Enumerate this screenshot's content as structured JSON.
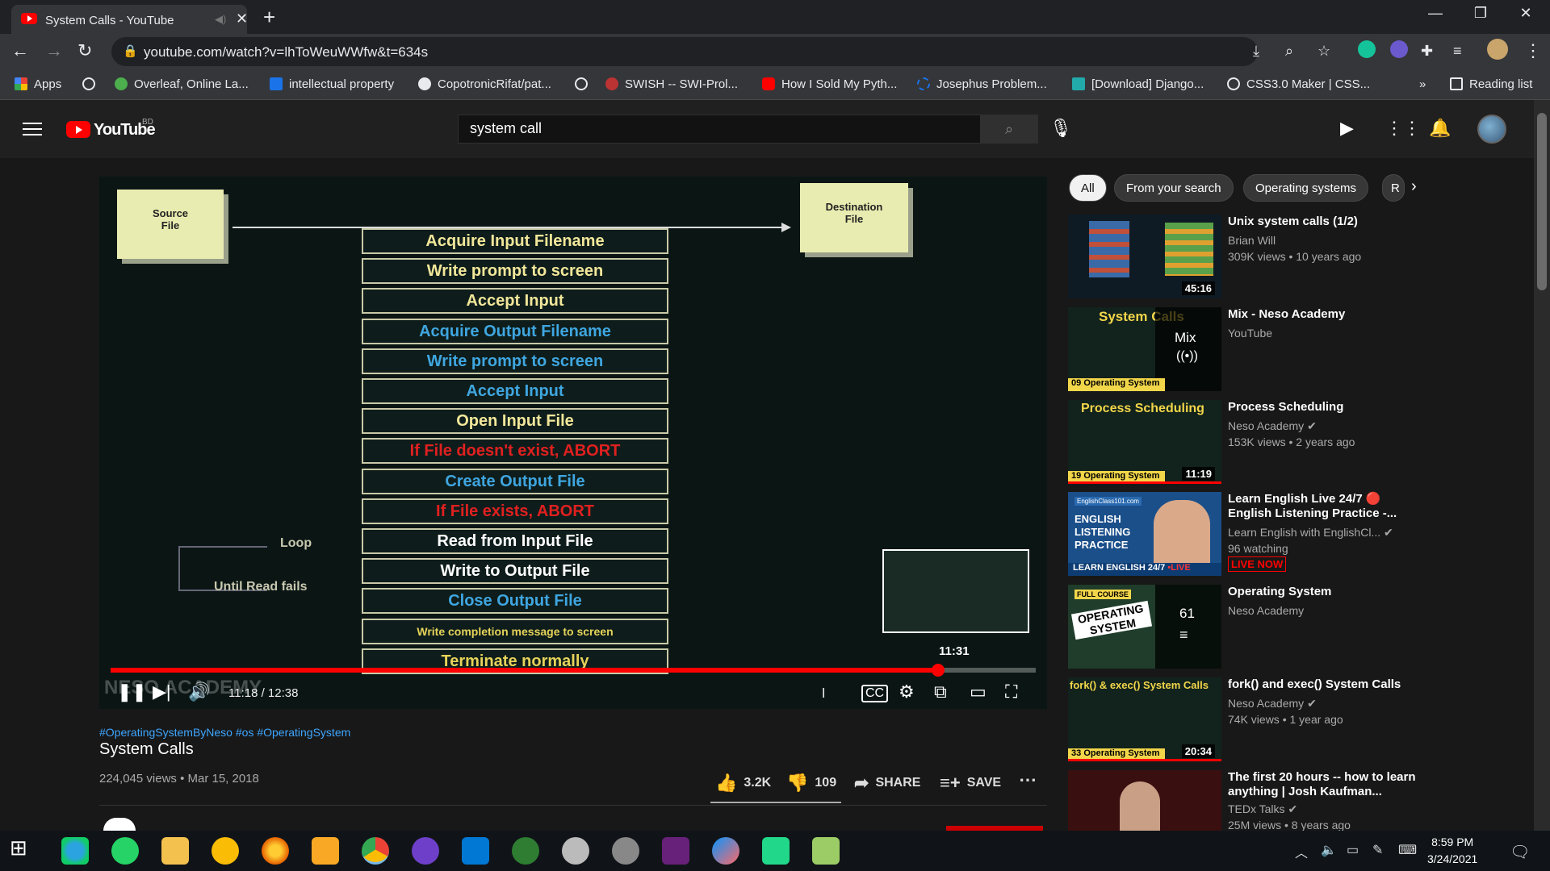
{
  "browser": {
    "tab_title": "System Calls - YouTube",
    "new_tab": "+",
    "url": "youtube.com/watch?v=lhToWeuWWfw&t=634s",
    "bookmarks": [
      {
        "label": "Apps",
        "color": "#e8453c"
      },
      {
        "label": "",
        "color": "#e8eaed"
      },
      {
        "label": "Overleaf, Online La...",
        "color": "#4cae4c"
      },
      {
        "label": "intellectual property",
        "color": "#1a73e8"
      },
      {
        "label": "CopotronicRifat/pat...",
        "color": "#e8eaed"
      },
      {
        "label": "",
        "color": "#e8eaed"
      },
      {
        "label": "SWISH -- SWI-Prol...",
        "color": "#b33"
      },
      {
        "label": "How I Sold My Pyth...",
        "color": "#f00"
      },
      {
        "label": "Josephus Problem...",
        "color": "#1a73e8"
      },
      {
        "label": "[Download] Django...",
        "color": "#2aa"
      },
      {
        "label": "CSS3.0 Maker | CSS...",
        "color": "#e8eaed"
      }
    ],
    "bookmarks_overflow": "»",
    "reading_list": "Reading list"
  },
  "youtube": {
    "logo_text": "YouTube",
    "country_code": "BD",
    "search_value": "system call"
  },
  "player": {
    "slide": {
      "source_label": "Source\nFile",
      "dest_label": "Destination\nFile",
      "steps": [
        {
          "text": "Acquire Input Filename",
          "color": "#f2e79a"
        },
        {
          "text": "Write prompt to screen",
          "color": "#f2e79a"
        },
        {
          "text": "Accept Input",
          "color": "#f2e79a"
        },
        {
          "text": "Acquire Output Filename",
          "color": "#3fa6e0"
        },
        {
          "text": "Write prompt to screen",
          "color": "#3fa6e0"
        },
        {
          "text": "Accept Input",
          "color": "#3fa6e0"
        },
        {
          "text": "Open Input File",
          "color": "#f2e79a"
        },
        {
          "text": "If File doesn't exist, ABORT",
          "color": "#e02020"
        },
        {
          "text": "Create Output File",
          "color": "#3fa6e0"
        },
        {
          "text": "If File exists, ABORT",
          "color": "#e02020"
        },
        {
          "text": "Read from Input File",
          "color": "#ffffff"
        },
        {
          "text": "Write to Output File",
          "color": "#ffffff"
        },
        {
          "text": "Close Output File",
          "color": "#3fa6e0"
        },
        {
          "text": "Write completion message to screen",
          "color": "#e6d35a"
        },
        {
          "text": "Terminate normally",
          "color": "#e6d35a"
        }
      ],
      "loop_label": "Loop",
      "until_label": "Until Read fails",
      "watermark": "NESO ACADEMY"
    },
    "preview_time": "11:31",
    "time_display": "11:18 / 12:38",
    "progress": 0.894
  },
  "video": {
    "hashtags": "#OperatingSystemByNeso #os #OperatingSystem",
    "title": "System Calls",
    "views": "224,045 views • Mar 15, 2018",
    "likes": "3.2K",
    "dislikes": "109",
    "share": "SHARE",
    "save": "SAVE"
  },
  "chips": [
    "All",
    "From your search",
    "Operating systems",
    "R"
  ],
  "recommendations": [
    {
      "title": "Unix system calls (1/2)",
      "channel": "Brian Will",
      "meta": "309K views • 10 years ago",
      "duration": "45:16",
      "verified": false
    },
    {
      "title": "Mix - Neso Academy",
      "channel": "YouTube",
      "meta": "",
      "duration": "",
      "mix_label": "Mix",
      "thumb_text": "System Calls",
      "thumb_num": "09",
      "thumb_sub": "Operating System"
    },
    {
      "title": "Process Scheduling",
      "channel": "Neso Academy",
      "meta": "153K views • 2 years ago",
      "duration": "11:19",
      "verified": true,
      "thumb_text": "Process Scheduling",
      "thumb_num": "19",
      "thumb_sub": "Operating System"
    },
    {
      "title": "Learn English Live 24/7 🔴 English Listening Practice -...",
      "channel": "Learn English with EnglishCl...",
      "meta": "96 watching",
      "live": "LIVE NOW",
      "verified": true,
      "thumb_site": "EnglishClass101.com",
      "thumb_text": "ENGLISH LISTENING PRACTICE",
      "thumb_bar": "LEARN ENGLISH 24/7",
      "thumb_live": "•LIVE"
    },
    {
      "title": "Operating System",
      "channel": "Neso Academy",
      "meta": "",
      "playlist_count": "61",
      "thumb_tag": "FULL COURSE",
      "thumb_text": "OPERATING SYSTEM"
    },
    {
      "title": "fork() and exec() System Calls",
      "channel": "Neso Academy",
      "meta": "74K views • 1 year ago",
      "duration": "20:34",
      "verified": true,
      "thumb_text": "fork() & exec() System Calls",
      "thumb_num": "33",
      "thumb_sub": "Operating System"
    },
    {
      "title": "The first 20 hours -- how to learn anything | Josh Kaufman...",
      "channel": "TEDx Talks",
      "meta": "25M views • 8 years ago",
      "verified": true
    }
  ],
  "taskbar": {
    "time": "8:59 PM",
    "date": "3/24/2021"
  }
}
